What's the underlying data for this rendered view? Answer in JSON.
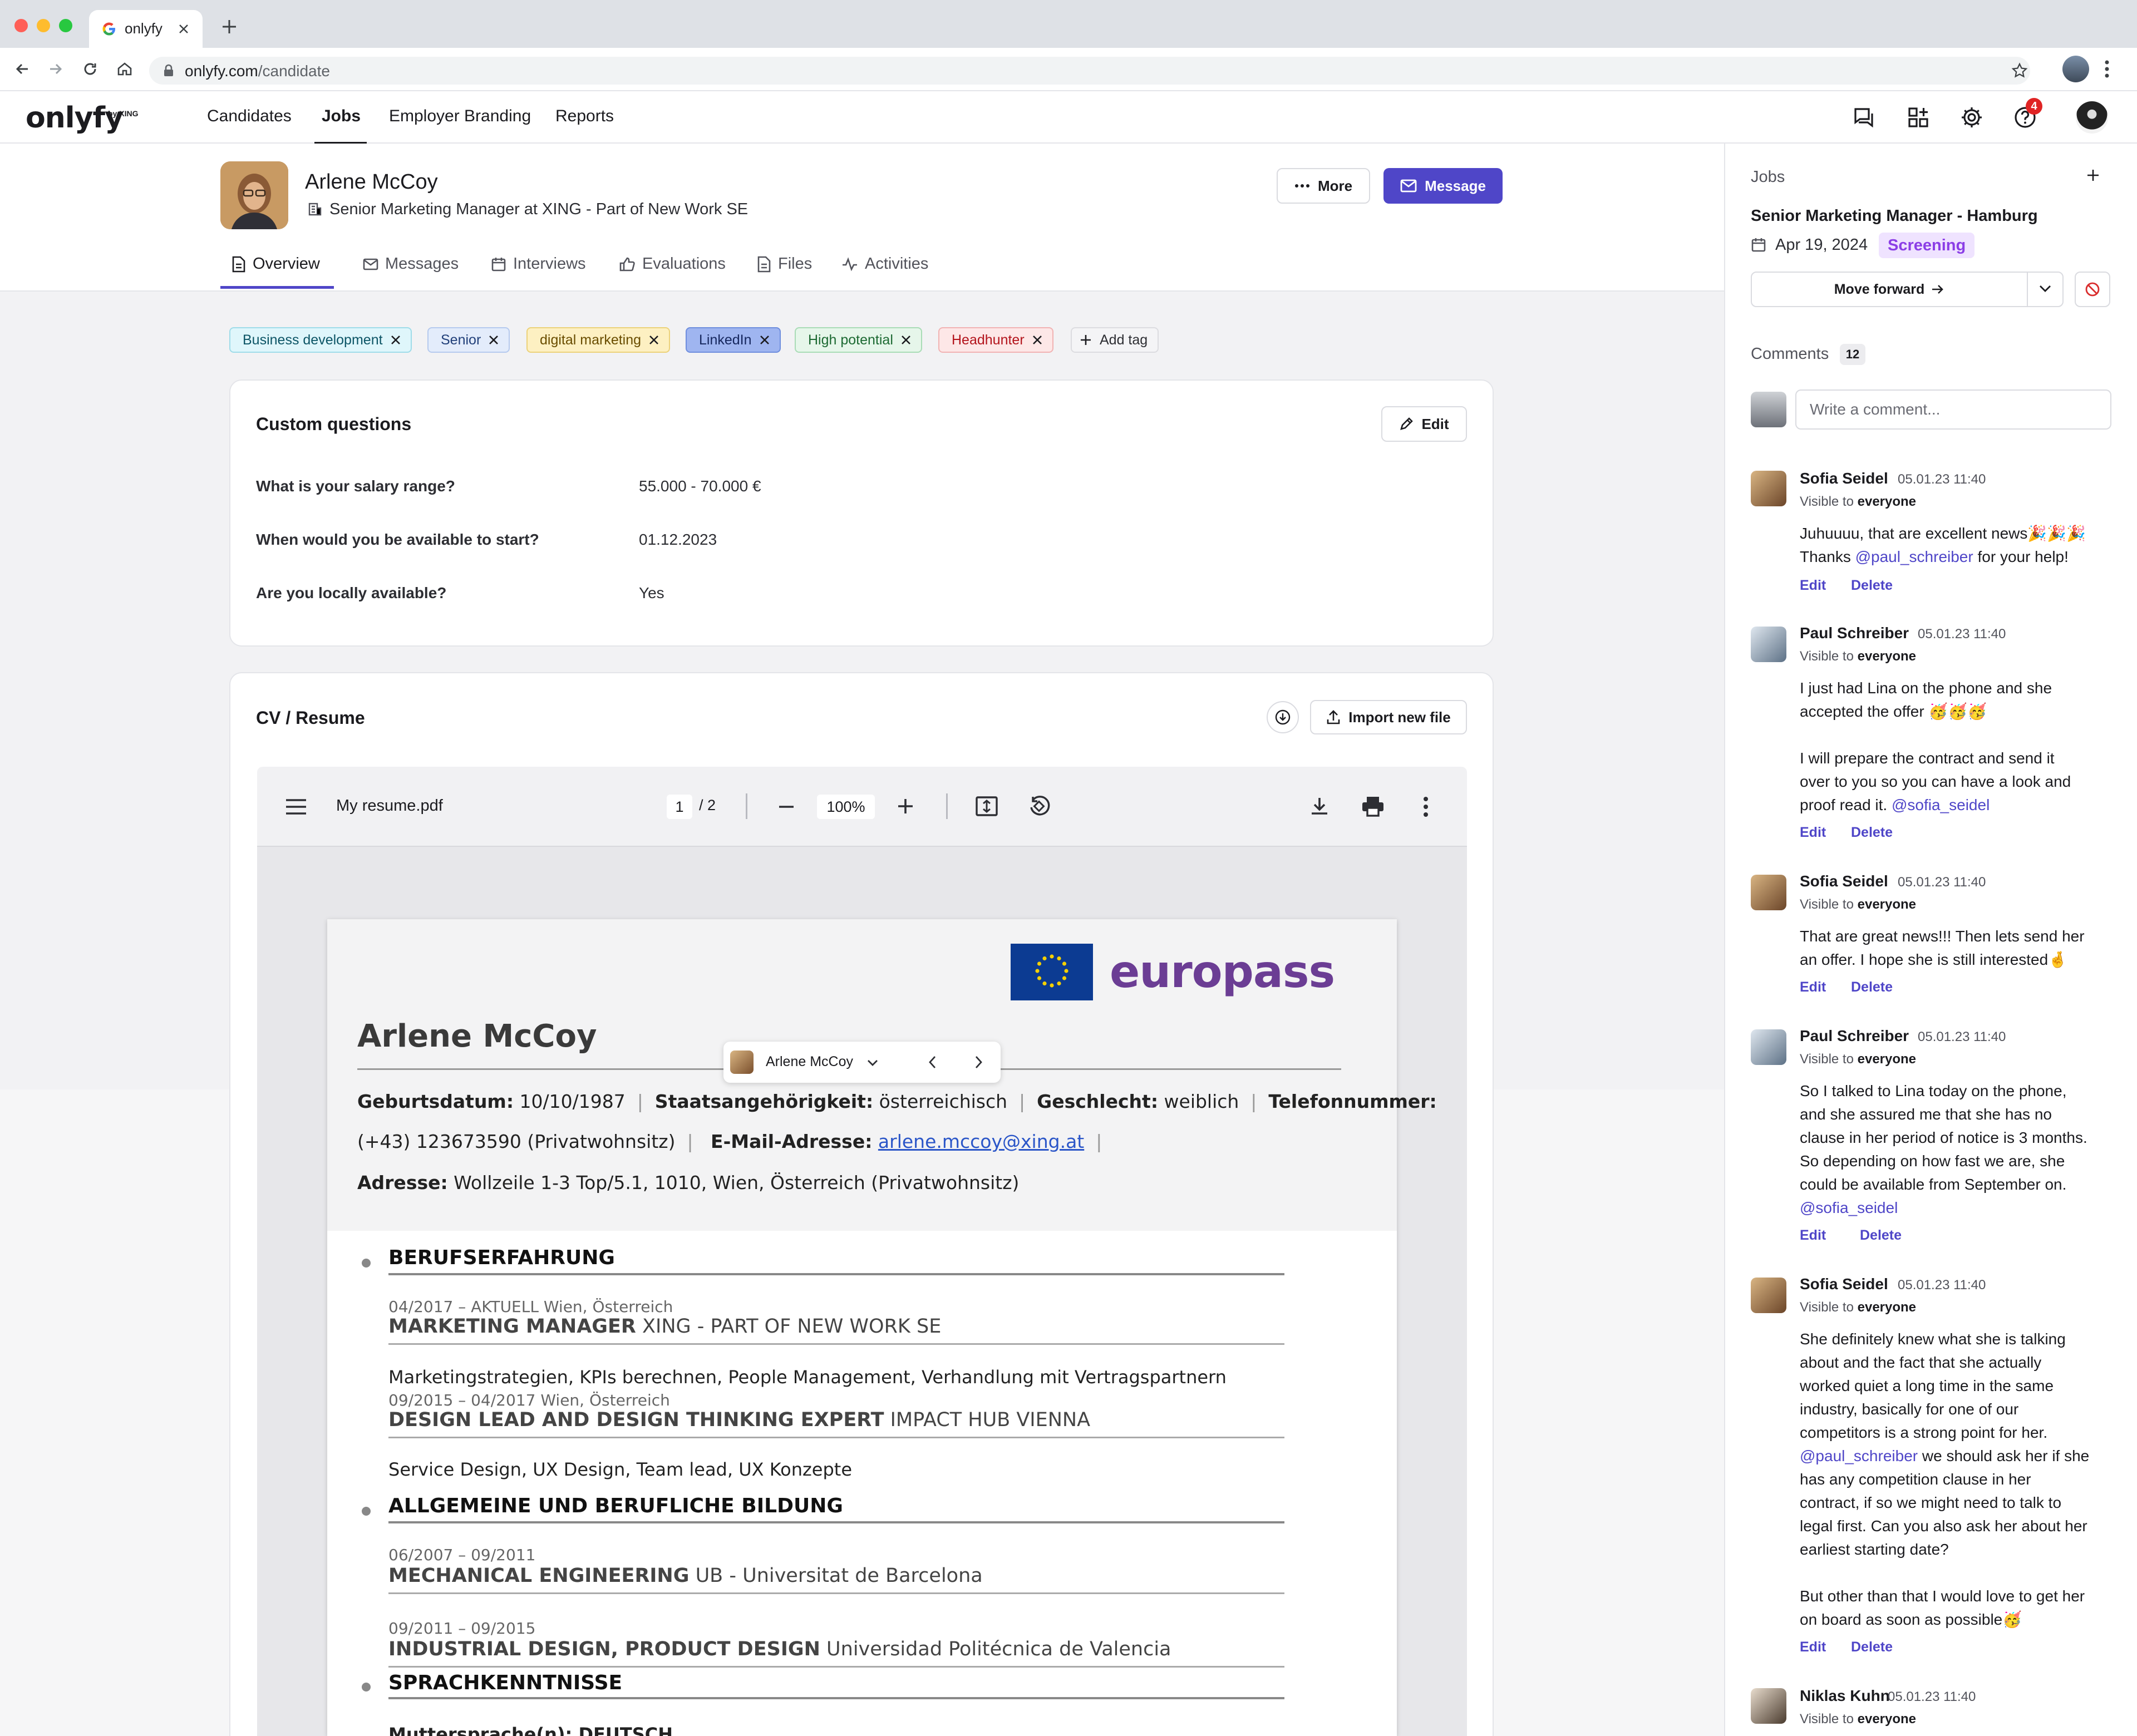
{
  "browser": {
    "tab_title": "onlyfy",
    "url_host": "onlyfy.com",
    "url_path": "/candidate"
  },
  "header": {
    "logo": "onlyfy",
    "logo_sub": "by XING",
    "nav": [
      "Candidates",
      "Jobs",
      "Employer Branding",
      "Reports"
    ],
    "active_nav": "Jobs",
    "help_badge": "4"
  },
  "candidate": {
    "name": "Arlene McCoy",
    "title": "Senior Marketing Manager at XING - Part of New Work SE",
    "more_label": "More",
    "message_label": "Message"
  },
  "tabs": [
    "Overview",
    "Messages",
    "Interviews",
    "Evaluations",
    "Files",
    "Activities"
  ],
  "tags": {
    "items": [
      "Business development",
      "Senior",
      "digital marketing",
      "LinkedIn",
      "High potential",
      "Headhunter"
    ],
    "add_label": "Add tag"
  },
  "custom_questions": {
    "title": "Custom questions",
    "edit_label": "Edit",
    "rows": [
      {
        "q": "What is your salary range?",
        "a": "55.000 - 70.000 €"
      },
      {
        "q": "When would you be available to start?",
        "a": "01.12.2023"
      },
      {
        "q": "Are you locally available?",
        "a": "Yes"
      }
    ]
  },
  "cv": {
    "title": "CV / Resume",
    "import_label": "Import new file",
    "file_name": "My resume.pdf",
    "page_current": "1",
    "page_total": "/ 2",
    "zoom": "100%",
    "floating_name": "Arlene McCoy",
    "doc": {
      "brand": "europass",
      "name": "Arlene McCoy",
      "line1_l1": "Geburtsdatum:",
      "line1_v1": " 10/10/1987",
      "line1_l2": "Staatsangehörigkeit:",
      "line1_v2": " österreichisch",
      "line1_l3": "Geschlecht:",
      "line1_v3": " weiblich",
      "line1_l4": "Telefonnummer:",
      "line2_v1": "(+43) 123673590 (Privatwohnsitz)",
      "line2_l2": "E-Mail-Adresse:",
      "line2_v2": "arlene.mccoy@xing.at",
      "line3_l1": "Adresse:",
      "line3_v1": " Wollzeile 1-3 Top/5.1, 1010, Wien, Österreich (Privatwohnsitz)",
      "sec1": "BERUFSERFAHRUNG",
      "job1_date": "04/2017 – AKTUELL Wien, Österreich",
      "job1_title": "MARKETING MANAGER",
      "job1_org": " XING - PART OF NEW WORK SE",
      "job1_desc": "Marketingstrategien, KPIs berechnen, People Management, Verhandlung mit Vertragspartnern",
      "job2_date": "09/2015 – 04/2017 Wien, Österreich",
      "job2_title": "DESIGN LEAD AND DESIGN THINKING EXPERT",
      "job2_org": " IMPACT HUB VIENNA",
      "job2_desc": "Service Design, UX Design, Team lead, UX Konzepte",
      "sec2": "ALLGEMEINE UND BERUFLICHE BILDUNG",
      "edu1_date": "06/2007 – 09/2011",
      "edu1_title": "MECHANICAL ENGINEERING",
      "edu1_org": " UB - Universitat de Barcelona",
      "edu2_date": "09/2011 – 09/2015",
      "edu2_title": "INDUSTRIAL DESIGN, PRODUCT DESIGN",
      "edu2_org": " Universidad Politécnica de Valencia",
      "sec3": "SPRACHKENNTNISSE",
      "lang_cut": "Muttersprache(n):  DEUTSCH"
    }
  },
  "sidebar": {
    "jobs_label": "Jobs",
    "job_title": "Senior Marketing Manager - Hamburg",
    "job_date": "Apr 19, 2024",
    "job_status": "Screening",
    "move_label": "Move forward",
    "comments_label": "Comments",
    "comments_count": "12",
    "comment_placeholder": "Write a comment...",
    "comments": [
      {
        "author": "Sofia Seidel",
        "date": "05.01.23 11:40",
        "visible_prefix": "Visible to",
        "visible_to": "everyone",
        "lines": [
          "Juhuuuu, that are excellent news🎉🎉🎉",
          "Thanks @paul_schreiber for your help!"
        ],
        "edit": "Edit",
        "delete": "Delete"
      },
      {
        "author": "Paul Schreiber",
        "date": "05.01.23 11:40",
        "visible_prefix": "Visible to",
        "visible_to": "everyone",
        "lines": [
          "I just had Lina on the phone and she",
          "accepted the offer 🥳🥳🥳",
          "",
          "I will prepare the contract and send it",
          "over to you so you can have a look and",
          "proof read it. @sofia_seidel"
        ],
        "edit": "Edit",
        "delete": "Delete"
      },
      {
        "author": "Sofia Seidel",
        "date": "05.01.23 11:40",
        "visible_prefix": "Visible to",
        "visible_to": "everyone",
        "lines": [
          "That are great news!!! Then lets send her",
          "an offer. I hope she is still interested🤞"
        ],
        "edit": "Edit",
        "delete": "Delete"
      },
      {
        "author": "Paul Schreiber",
        "date": "05.01.23 11:40",
        "visible_prefix": "Visible to",
        "visible_to": "everyone",
        "lines": [
          "So I talked to Lina today on the phone,",
          "and she assured me that she has no",
          "clause in her period of notice is 3 months.",
          "So depending on how fast we are, she",
          "could be available from September on.",
          "@sofia_seidel"
        ],
        "edit": "Edit",
        "delete": "Delete"
      },
      {
        "author": "Sofia Seidel",
        "date": "05.01.23 11:40",
        "visible_prefix": "Visible to",
        "visible_to": "everyone",
        "lines": [
          "She definitely knew what she is talking",
          "about and the fact that she actually",
          "worked quiet a long time in the same",
          "industry, basically for one of our",
          "competitors is a strong point for her.",
          "@paul_schreiber we should ask her if she",
          "has any competition clause in her",
          "contract, if so we might need to talk to",
          "legal first. Can you also ask her about her",
          "earliest starting date?",
          "",
          "But other than that I would love to get her",
          "on board as soon as possible🥳"
        ],
        "edit": "Edit",
        "delete": "Delete"
      },
      {
        "author": "Niklas Kuhn",
        "date": "05.01.23 11:40",
        "visible_prefix": "Visible to",
        "visible_to": "everyone",
        "lines": [],
        "edit": "",
        "delete": ""
      }
    ]
  },
  "colors": {
    "brand": "#4f46c8",
    "screening_bg": "#efe3ff",
    "screening_text": "#8b3ee6",
    "badge_red": "#e02424"
  },
  "icons": [
    "search-icon",
    "chat-icon",
    "apps-icon",
    "gear-icon",
    "help-icon",
    "pencil-icon",
    "download-icon",
    "upload-icon",
    "print-icon",
    "menu-icon",
    "rotate-icon",
    "fit-page-icon",
    "chevron-down-icon",
    "close-icon",
    "plus-icon",
    "block-icon",
    "calendar-icon",
    "building-icon"
  ]
}
